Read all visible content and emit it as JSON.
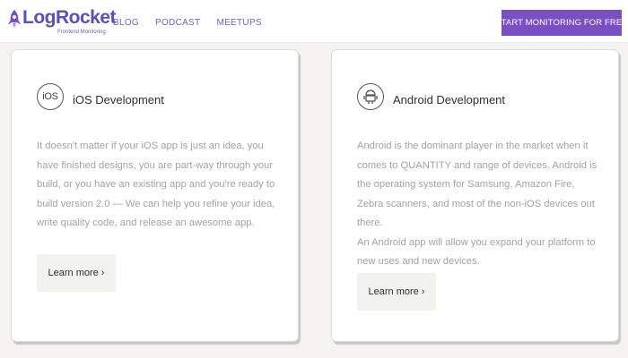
{
  "header": {
    "logo_text": "LogRocket",
    "logo_subtitle": "Frontend Monitoring",
    "nav": [
      "BLOG",
      "PODCAST",
      "MEETUPS"
    ],
    "cta_label": "START MONITORING FOR FREE",
    "brand_color": "#7a4fc4"
  },
  "cards": [
    {
      "icon": "ios-icon",
      "icon_text": "iOS",
      "title": "iOS Development",
      "paragraphs": [
        "It doesn't matter if your iOS app is just an idea, you have finished designs, you are part-way through your build, or you have an existing app and you're ready to build version 2.0 — We can help you refine your idea, write quality code, and release an awesome app."
      ],
      "button_label": "Learn more ›"
    },
    {
      "icon": "android-icon",
      "title": "Android Development",
      "paragraphs": [
        "Android is the dominant player in the market when it comes to QUANTITY and range of devices. Android is the operating system for Samsung, Amazon Fire, Zebra scanners, and most of the non-iOS devices out there.",
        "An Android app will allow you expand your platform to new uses and new devices."
      ],
      "button_label": "Learn more ›"
    }
  ]
}
